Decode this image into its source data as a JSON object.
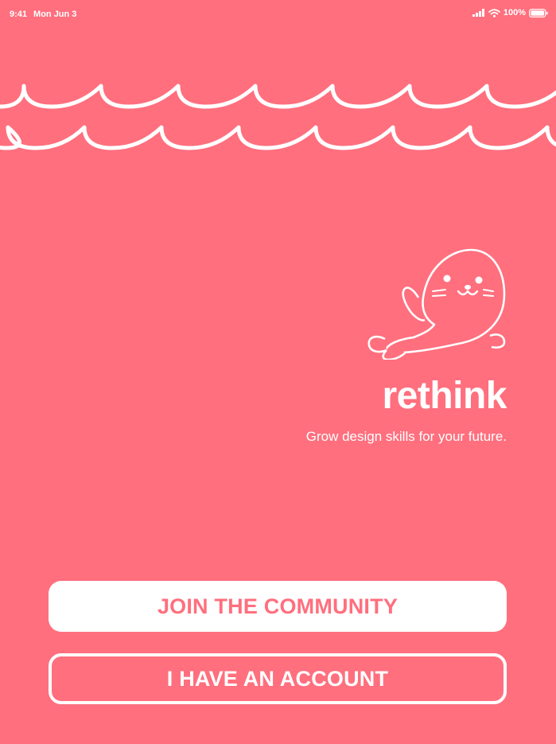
{
  "colors": {
    "background": "#ff6f7e",
    "foreground": "#ffffff",
    "accent": "#ff6f7e"
  },
  "status_bar": {
    "time": "9:41",
    "date": "Mon Jun 3",
    "battery": "100%",
    "icons": [
      "signal-icon",
      "wifi-icon",
      "battery-icon"
    ]
  },
  "brand": {
    "name": "rethink",
    "tagline": "Grow design skills for your future.",
    "mascot": "seal-mascot"
  },
  "actions": {
    "join_label": "JOIN THE COMMUNITY",
    "account_label": "I HAVE AN ACCOUNT"
  }
}
